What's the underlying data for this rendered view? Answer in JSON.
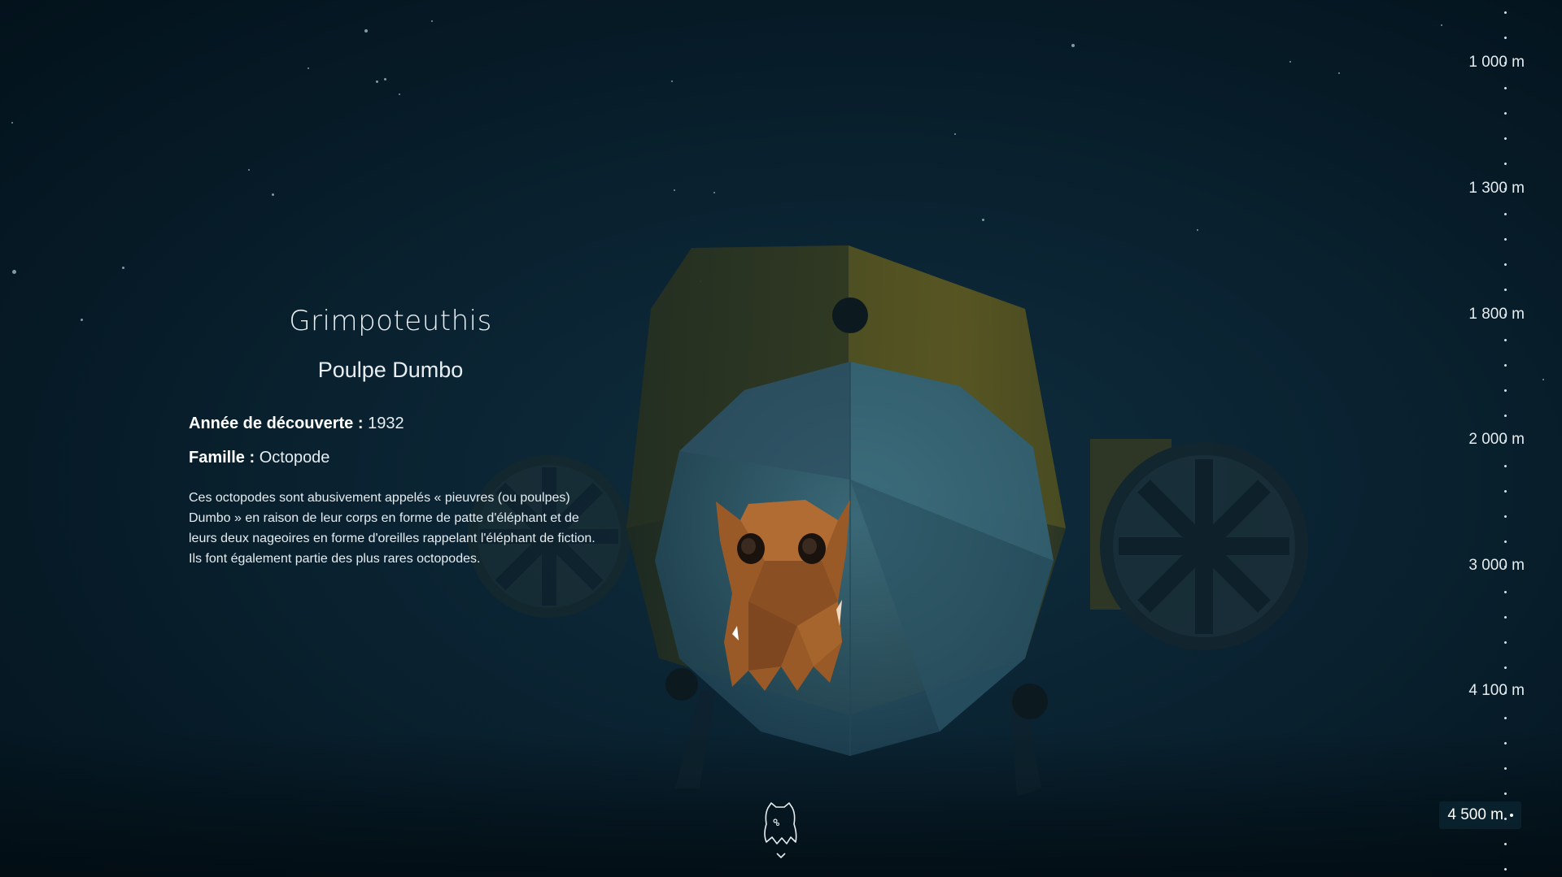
{
  "creature": {
    "scientific_name": "Grimpoteuthis",
    "common_name": "Poulpe Dumbo",
    "discovery_label": "Année de découverte :",
    "discovery_year": "1932",
    "family_label": "Famille :",
    "family_value": "Octopode",
    "description_lines": [
      "Ces octopodes sont abusivement appelés « pieuvres (ou poulpes)",
      "Dumbo » en raison de leur corps en forme de patte d'éléphant et de",
      "leurs deux nageoires en forme d'oreilles rappelant l'éléphant de fiction.",
      "Ils font également partie des plus rares octopodes."
    ]
  },
  "depth_gauge": {
    "marks": [
      "1 000 m",
      "1 300 m",
      "1 800 m",
      "2 000 m",
      "3 000 m",
      "4 100 m"
    ],
    "current": "4 500 m"
  },
  "nav": {
    "next_icon": "creature-outline-icon",
    "scroll_icon": "chevron-down-icon"
  },
  "colors": {
    "background": "#0b2433",
    "submarine_hull": "#4a4a1e",
    "dome": "#2f5566",
    "octopus": "#a0612c",
    "text": "#e6edf1"
  }
}
